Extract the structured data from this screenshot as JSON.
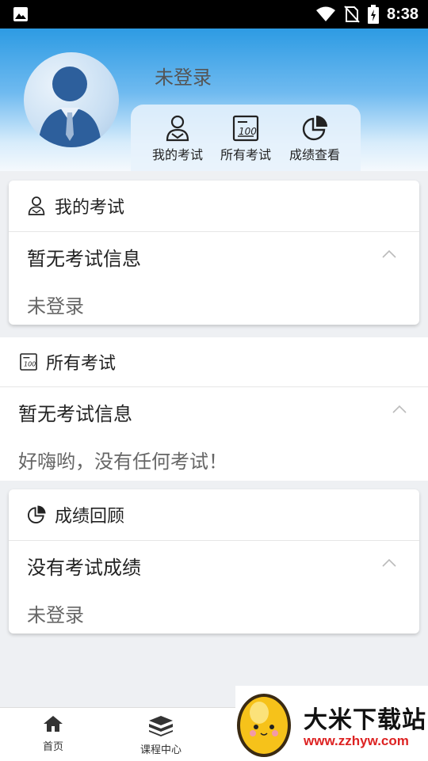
{
  "status_bar": {
    "time": "8:38"
  },
  "profile": {
    "username": "未登录"
  },
  "quick_actions": [
    {
      "label": "我的考试",
      "icon": "user-exam-icon"
    },
    {
      "label": "所有考试",
      "icon": "score-sheet-icon"
    },
    {
      "label": "成绩查看",
      "icon": "pie-chart-icon"
    }
  ],
  "my_exams": {
    "header": "我的考试",
    "title": "暂无考试信息",
    "subtitle": "未登录"
  },
  "all_exams": {
    "header": "所有考试",
    "title": "暂无考试信息",
    "subtitle": "好嗨哟，没有任何考试！"
  },
  "score_review": {
    "header": "成绩回顾",
    "title": "没有考试成绩",
    "subtitle": "未登录"
  },
  "bottom_nav": [
    {
      "label": "首页",
      "icon": "home-icon"
    },
    {
      "label": "课程中心",
      "icon": "books-icon"
    }
  ],
  "watermark": {
    "title": "大米下载站",
    "url": "www.zzhyw.com"
  }
}
